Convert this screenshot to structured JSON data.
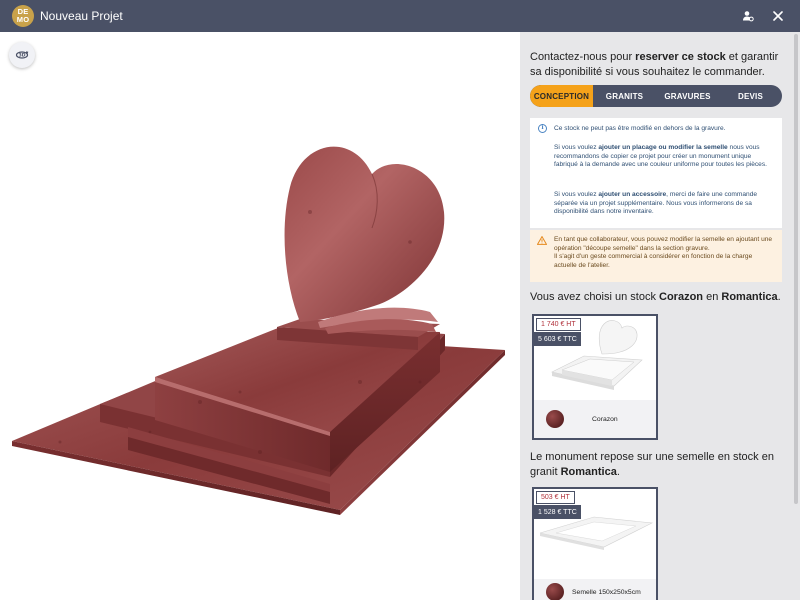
{
  "header": {
    "logo_line1": "DE",
    "logo_line2": "MO",
    "title": "Nouveau Projet"
  },
  "panel": {
    "contact": {
      "t1": "Contactez-nous pour ",
      "b1": "reserver ce stock",
      "t2": " et garantir sa disponibilité si vous souhaitez le commander."
    },
    "tabs": [
      "CONCEPTION",
      "GRANITS",
      "GRAVURES",
      "DEVIS"
    ],
    "active_tab": "CONCEPTION",
    "info": {
      "line1": "Ce stock ne peut pas être modifié en dehors de la gravure.",
      "p2_a": "Si vous voulez ",
      "p2_b": "ajouter un placage ou modifier la semelle",
      "p2_c": " nous vous recommandons de copier ce projet pour créer un monument unique fabriqué à la demande avec une couleur uniforme pour toutes les pièces.",
      "p3_a": "Si vous voulez ",
      "p3_b": "ajouter un accessoire",
      "p3_c": ", merci de faire une commande séparée via un projet supplémentaire. Nous vous informerons de sa disponibilité dans notre inventaire."
    },
    "warning": {
      "l1": "En tant que collaborateur, vous pouvez modifier la semelle en ajoutant une opération \"découpe semelle\" dans la section gravure.",
      "l2": "Il s'agit d'un geste commercial à considérer en fonction de la charge actuelle de l'atelier."
    },
    "choice": {
      "t1": "Vous avez choisi un stock ",
      "stock": "Corazon",
      "t2": " en ",
      "granite": "Romantica",
      "t3": "."
    },
    "card1": {
      "price_ht": "1 740 € HT",
      "price_ttc": "5 603 € TTC",
      "name": "Corazon"
    },
    "semelle": {
      "t1": "Le monument repose sur une semelle en stock en granit ",
      "granite": "Romantica",
      "t2": "."
    },
    "card2": {
      "price_ht": "503 € HT",
      "price_ttc": "1 528 € TTC",
      "name": "Semelle 150x250x5cm"
    }
  },
  "colors": {
    "header_bg": "#4a5166",
    "accent": "#f5a21a",
    "panel_bg": "#e7e7e9",
    "granite": "#8a3b3b"
  }
}
